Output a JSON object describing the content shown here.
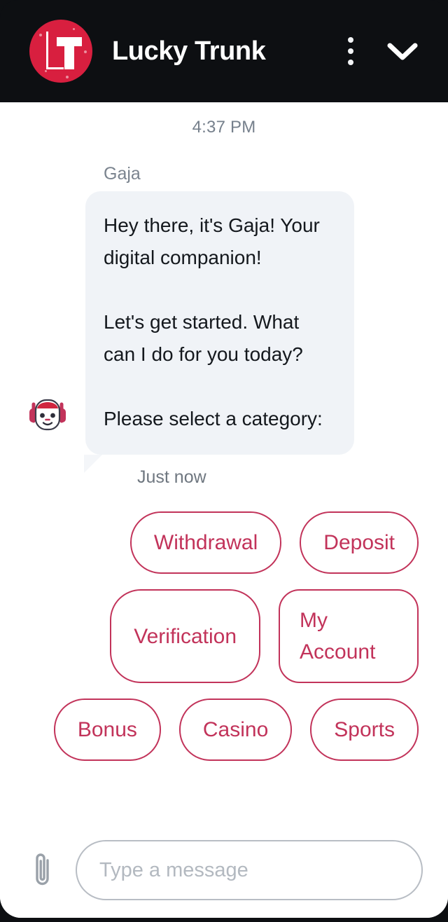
{
  "header": {
    "title": "Lucky Trunk",
    "avatar_alt": "LT",
    "brand_color": "#d81f3f",
    "menu_icon": "kebab-menu-icon",
    "collapse_icon": "chevron-down-icon"
  },
  "conversation": {
    "day_time": "4:37 PM",
    "message": {
      "sender": "Gaja",
      "avatar_icon": "bot-robot-avatar",
      "paragraphs": [
        "Hey there, it's Gaja! Your digital companion!",
        "Let's get started. What can I do for you today?",
        "Please select a category:"
      ],
      "timestamp": "Just now"
    }
  },
  "quick_replies": {
    "accent_color": "#c2335a",
    "items": [
      {
        "label": "Withdrawal",
        "multiline": false
      },
      {
        "label": "Deposit",
        "multiline": false
      },
      {
        "label": "Verification",
        "multiline": false
      },
      {
        "label": "My Account",
        "multiline": true
      },
      {
        "label": "Bonus",
        "multiline": false
      },
      {
        "label": "Casino",
        "multiline": false
      },
      {
        "label": "Sports",
        "multiline": false
      }
    ]
  },
  "composer": {
    "attach_icon": "paperclip-icon",
    "input_value": "",
    "input_placeholder": "Type a message"
  }
}
